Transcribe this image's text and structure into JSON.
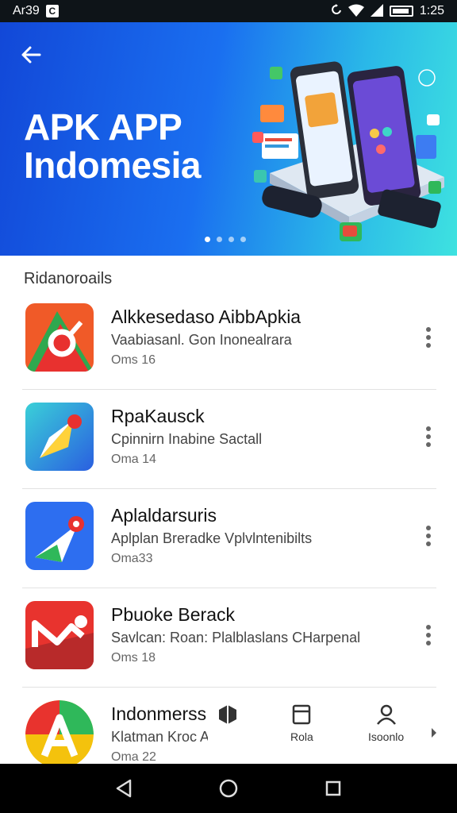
{
  "status_bar": {
    "time_left": "Ar39",
    "time_right": "1:25",
    "icons": [
      "notification-icon",
      "sync-icon",
      "wifi-icon",
      "signal-icon",
      "battery-icon"
    ]
  },
  "hero": {
    "title_line1": "APK APP",
    "title_line2": "Indomesia",
    "carousel_pages": 4,
    "carousel_active": 1,
    "colors": {
      "start": "#1248d8",
      "end": "#3ee2e0"
    }
  },
  "section": {
    "title": "Ridanoroails"
  },
  "apps": [
    {
      "name": "Alkkesedaso AibbApkia",
      "desc": "Vaabiasanl. Gon Inonealrara",
      "meta": "Oms 16",
      "icon": "red-orange-a-icon"
    },
    {
      "name": "RpaKausck",
      "desc": "Cpinnirn Inabine Sactall",
      "meta": "Oma 14",
      "icon": "blue-arrow-icon"
    },
    {
      "name": "Aplaldarsuris",
      "desc": "Aplplan Breradke Vplvlntenibilts",
      "meta": "Oma33",
      "icon": "blue-pin-icon"
    },
    {
      "name": "Pbuoke Berack",
      "desc": "Savlcan: Roan: Plalblaslans CHarpenal",
      "meta": "Oms 18",
      "icon": "red-m-icon"
    },
    {
      "name": "Indonmerss",
      "desc": "Klatman Kroc Afuolsann,",
      "meta": "Oma 22",
      "icon": "yellow-a-icon"
    }
  ],
  "tabbar": {
    "tabs": [
      {
        "label": "",
        "icon": "box-icon"
      },
      {
        "label": "Rola",
        "icon": "document-icon"
      },
      {
        "label": "Isoonlo",
        "icon": "person-icon"
      }
    ],
    "next_icon": "chevron-right-icon"
  },
  "navbar": {
    "icons": [
      "back-triangle-icon",
      "home-circle-icon",
      "recents-square-icon"
    ]
  }
}
